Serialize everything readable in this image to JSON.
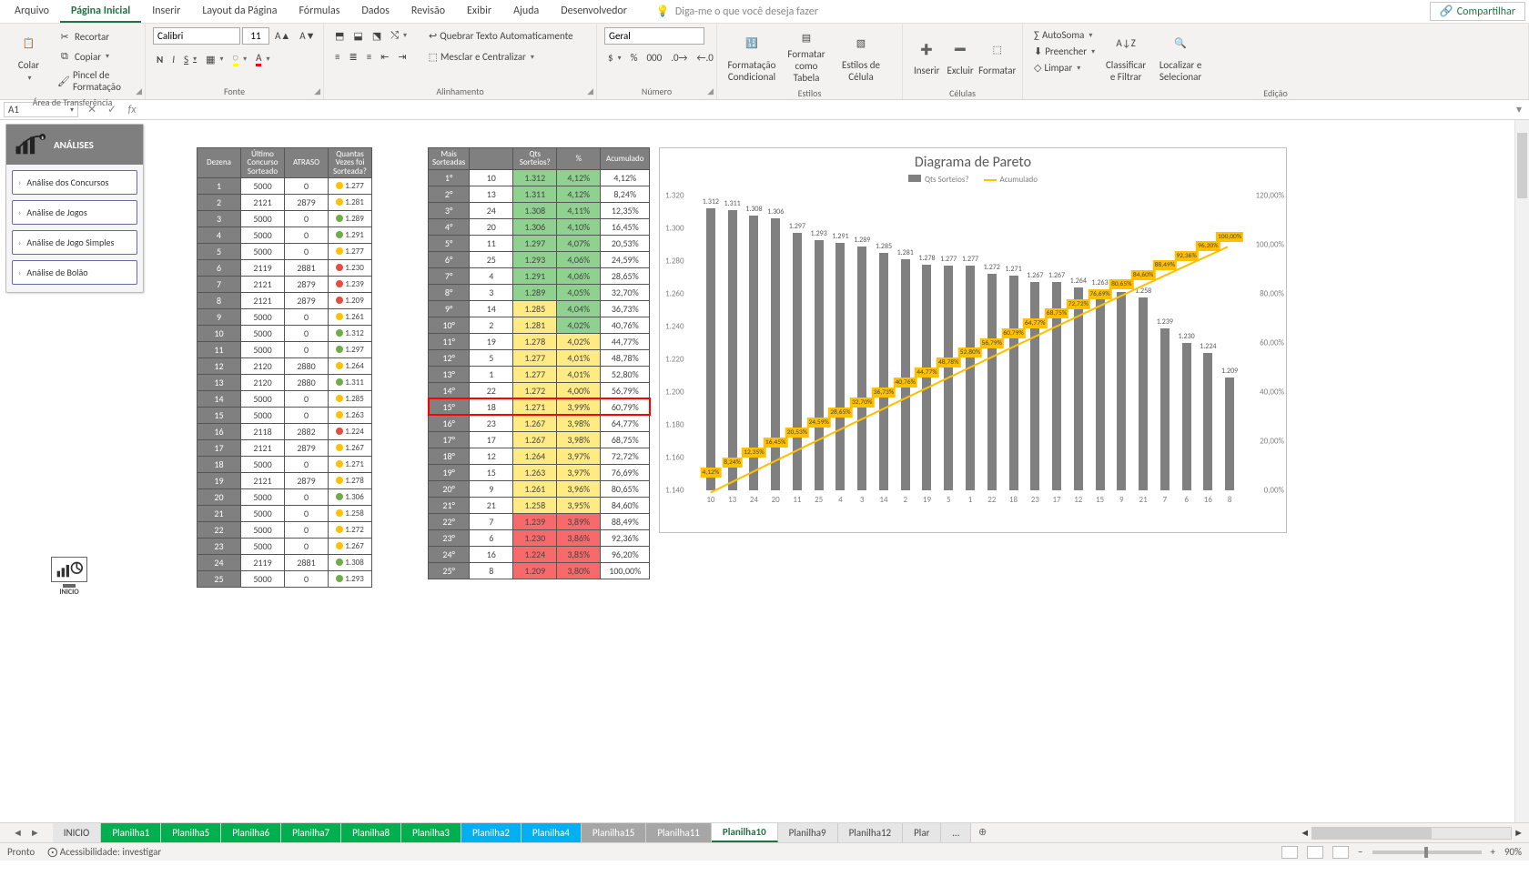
{
  "menu": {
    "items": [
      "Arquivo",
      "Página Inicial",
      "Inserir",
      "Layout da Página",
      "Fórmulas",
      "Dados",
      "Revisão",
      "Exibir",
      "Ajuda",
      "Desenvolvedor"
    ],
    "active": 1,
    "tellme": "Diga-me o que você deseja fazer",
    "share": "Compartilhar"
  },
  "ribbon": {
    "clipboard": {
      "paste": "Colar",
      "cut": "Recortar",
      "copy": "Copiar",
      "painter": "Pincel de Formatação",
      "label": "Área de Transferência"
    },
    "font": {
      "name": "Calibri",
      "size": "11",
      "bold": "N",
      "italic": "I",
      "underline": "S",
      "label": "Fonte"
    },
    "alignment": {
      "wrap": "Quebrar Texto Automaticamente",
      "merge": "Mesclar e Centralizar",
      "label": "Alinhamento"
    },
    "number": {
      "format": "Geral",
      "label": "Número"
    },
    "styles": {
      "cond": "Formatação Condicional",
      "table": "Formatar como Tabela",
      "cell": "Estilos de Célula",
      "label": "Estilos"
    },
    "cells": {
      "insert": "Inserir",
      "delete": "Excluir",
      "format": "Formatar",
      "label": "Células"
    },
    "editing": {
      "autosum": "AutoSoma",
      "fill": "Preencher",
      "clear": "Limpar",
      "sort": "Classificar e Filtrar",
      "find": "Localizar e Selecionar",
      "label": "Edição"
    }
  },
  "fxbar": {
    "namebox": "A1",
    "fx": "fx"
  },
  "side": {
    "title": "ANÁLISES",
    "buttons": [
      "Análise dos Concursos",
      "Análise de Jogos",
      "Análise de Jogo Simples",
      "Análise de Bolão"
    ]
  },
  "inicio_label": "INICIO",
  "table1": {
    "headers": [
      "Dezena",
      "Último Concurso Sorteado",
      "ATRASO",
      "Quantas Vezes foi Sorteada?"
    ],
    "rows": [
      [
        "1",
        "5000",
        "0",
        "1.277",
        "y"
      ],
      [
        "2",
        "2121",
        "2879",
        "1.281",
        "y"
      ],
      [
        "3",
        "5000",
        "0",
        "1.289",
        "g"
      ],
      [
        "4",
        "5000",
        "0",
        "1.291",
        "g"
      ],
      [
        "5",
        "5000",
        "0",
        "1.277",
        "y"
      ],
      [
        "6",
        "2119",
        "2881",
        "1.230",
        "r"
      ],
      [
        "7",
        "2121",
        "2879",
        "1.239",
        "r"
      ],
      [
        "8",
        "2121",
        "2879",
        "1.209",
        "r"
      ],
      [
        "9",
        "5000",
        "0",
        "1.261",
        "y"
      ],
      [
        "10",
        "5000",
        "0",
        "1.312",
        "g"
      ],
      [
        "11",
        "5000",
        "0",
        "1.297",
        "g"
      ],
      [
        "12",
        "2120",
        "2880",
        "1.264",
        "y"
      ],
      [
        "13",
        "2120",
        "2880",
        "1.311",
        "g"
      ],
      [
        "14",
        "5000",
        "0",
        "1.285",
        "y"
      ],
      [
        "15",
        "5000",
        "0",
        "1.263",
        "y"
      ],
      [
        "16",
        "2118",
        "2882",
        "1.224",
        "r"
      ],
      [
        "17",
        "2121",
        "2879",
        "1.267",
        "y"
      ],
      [
        "18",
        "5000",
        "0",
        "1.271",
        "y"
      ],
      [
        "19",
        "2121",
        "2879",
        "1.278",
        "y"
      ],
      [
        "20",
        "5000",
        "0",
        "1.306",
        "g"
      ],
      [
        "21",
        "5000",
        "0",
        "1.258",
        "y"
      ],
      [
        "22",
        "5000",
        "0",
        "1.272",
        "y"
      ],
      [
        "23",
        "5000",
        "0",
        "1.267",
        "y"
      ],
      [
        "24",
        "2119",
        "2881",
        "1.308",
        "g"
      ],
      [
        "25",
        "5000",
        "0",
        "1.293",
        "g"
      ]
    ]
  },
  "table2": {
    "headers": [
      "Mais Sorteadas",
      "Qts Sorteios?",
      "%",
      "Acumulado"
    ],
    "rows": [
      [
        "1°",
        "10",
        "1.312",
        "4,12%",
        "4,12%"
      ],
      [
        "2°",
        "13",
        "1.311",
        "4,12%",
        "8,24%"
      ],
      [
        "3°",
        "24",
        "1.308",
        "4,11%",
        "12,35%"
      ],
      [
        "4°",
        "20",
        "1.306",
        "4,10%",
        "16,45%"
      ],
      [
        "5°",
        "11",
        "1.297",
        "4,07%",
        "20,53%"
      ],
      [
        "6°",
        "25",
        "1.293",
        "4,06%",
        "24,59%"
      ],
      [
        "7°",
        "4",
        "1.291",
        "4,06%",
        "28,65%"
      ],
      [
        "8°",
        "3",
        "1.289",
        "4,05%",
        "32,70%"
      ],
      [
        "9°",
        "14",
        "1.285",
        "4,04%",
        "36,73%"
      ],
      [
        "10°",
        "2",
        "1.281",
        "4,02%",
        "40,76%"
      ],
      [
        "11°",
        "19",
        "1.278",
        "4,02%",
        "44,77%"
      ],
      [
        "12°",
        "5",
        "1.277",
        "4,01%",
        "48,78%"
      ],
      [
        "13°",
        "1",
        "1.277",
        "4,01%",
        "52,80%"
      ],
      [
        "14°",
        "22",
        "1.272",
        "4,00%",
        "56,79%"
      ],
      [
        "15°",
        "18",
        "1.271",
        "3,99%",
        "60,79%"
      ],
      [
        "16°",
        "23",
        "1.267",
        "3,98%",
        "64,77%"
      ],
      [
        "17°",
        "17",
        "1.267",
        "3,98%",
        "68,75%"
      ],
      [
        "18°",
        "12",
        "1.264",
        "3,97%",
        "72,72%"
      ],
      [
        "19°",
        "15",
        "1.263",
        "3,97%",
        "76,69%"
      ],
      [
        "20°",
        "9",
        "1.261",
        "3,96%",
        "80,65%"
      ],
      [
        "21°",
        "21",
        "1.258",
        "3,95%",
        "84,60%"
      ],
      [
        "22°",
        "7",
        "1.239",
        "3,89%",
        "88,49%"
      ],
      [
        "23°",
        "6",
        "1.230",
        "3,86%",
        "92,36%"
      ],
      [
        "24°",
        "16",
        "1.224",
        "3,85%",
        "96,20%"
      ],
      [
        "25°",
        "8",
        "1.209",
        "3,80%",
        "100,00%"
      ]
    ],
    "highlight_row": 14
  },
  "t2_colors_pct": [
    "g",
    "g",
    "g",
    "g",
    "g",
    "g",
    "g",
    "g",
    "g",
    "g",
    "y",
    "y",
    "y",
    "y",
    "y",
    "y",
    "y",
    "y",
    "y",
    "y",
    "y",
    "r",
    "r",
    "r",
    "r"
  ],
  "t2_colors_qts": [
    "g",
    "g",
    "g",
    "g",
    "g",
    "g",
    "g",
    "g",
    "y",
    "y",
    "y",
    "y",
    "y",
    "y",
    "y",
    "y",
    "y",
    "y",
    "y",
    "y",
    "y",
    "r",
    "r",
    "r",
    "r"
  ],
  "chart_data": {
    "type": "pareto",
    "title": "Diagrama de Pareto",
    "legend": [
      "Qts Sorteios?",
      "Acumulado"
    ],
    "categories": [
      "10",
      "13",
      "24",
      "20",
      "11",
      "25",
      "4",
      "3",
      "14",
      "2",
      "19",
      "5",
      "1",
      "22",
      "18",
      "23",
      "17",
      "12",
      "15",
      "9",
      "21",
      "7",
      "6",
      "16",
      "8"
    ],
    "bars": [
      1312,
      1311,
      1308,
      1306,
      1297,
      1293,
      1291,
      1289,
      1285,
      1281,
      1278,
      1277,
      1277,
      1272,
      1271,
      1267,
      1267,
      1264,
      1263,
      1261,
      1258,
      1239,
      1230,
      1224,
      1209
    ],
    "bar_labels": [
      "1.312",
      "1.311",
      "1.308",
      "1.306",
      "1.297",
      "1.293",
      "1.291",
      "1.289",
      "1.285",
      "1.281",
      "1.278",
      "1.277",
      "1.277",
      "1.272",
      "1.271",
      "1.267",
      "1.267",
      "1.264",
      "1.263",
      "1.261",
      "1.258",
      "1.239",
      "1.230",
      "1.224",
      "1.209"
    ],
    "cum_pct": [
      4.12,
      8.24,
      12.35,
      16.45,
      20.53,
      24.59,
      28.65,
      32.7,
      36.73,
      40.76,
      44.77,
      48.78,
      52.8,
      56.79,
      60.79,
      64.77,
      68.75,
      72.72,
      76.69,
      80.65,
      84.6,
      88.49,
      92.36,
      96.2,
      100.0
    ],
    "cum_labels": [
      "4,12%",
      "8,24%",
      "12,35%",
      "16,45%",
      "20,53%",
      "24,59%",
      "28,65%",
      "32,70%",
      "36,73%",
      "40,76%",
      "44,77%",
      "48,78%",
      "52,80%",
      "56,79%",
      "60,79%",
      "64,77%",
      "68,75%",
      "72,72%",
      "76,69%",
      "80,65%",
      "84,60%",
      "88,49%",
      "92,36%",
      "96,20%",
      "100,00%"
    ],
    "y1_ticks": [
      "1.140",
      "1.160",
      "1.180",
      "1.200",
      "1.220",
      "1.240",
      "1.260",
      "1.280",
      "1.300",
      "1.320"
    ],
    "y1_range": [
      1140,
      1320
    ],
    "y2_ticks": [
      "0,00%",
      "20,00%",
      "40,00%",
      "60,00%",
      "80,00%",
      "100,00%",
      "120,00%"
    ],
    "y2_range": [
      0,
      120
    ]
  },
  "tabs": {
    "items": [
      {
        "label": "INICIO",
        "cls": ""
      },
      {
        "label": "Planilha1",
        "cls": "green"
      },
      {
        "label": "Planilha5",
        "cls": "green"
      },
      {
        "label": "Planilha6",
        "cls": "green"
      },
      {
        "label": "Planilha7",
        "cls": "green"
      },
      {
        "label": "Planilha8",
        "cls": "green"
      },
      {
        "label": "Planilha3",
        "cls": "green"
      },
      {
        "label": "Planilha2",
        "cls": "blue"
      },
      {
        "label": "Planilha4",
        "cls": "blue"
      },
      {
        "label": "Planilha15",
        "cls": "grey"
      },
      {
        "label": "Planilha11",
        "cls": "grey"
      },
      {
        "label": "Planilha10",
        "cls": "on"
      },
      {
        "label": "Planilha9",
        "cls": ""
      },
      {
        "label": "Planilha12",
        "cls": ""
      },
      {
        "label": "Plar",
        "cls": ""
      }
    ],
    "ellipsis": "…"
  },
  "status": {
    "ready": "Pronto",
    "access": "Acessibilidade: investigar",
    "zoom": "90%"
  }
}
